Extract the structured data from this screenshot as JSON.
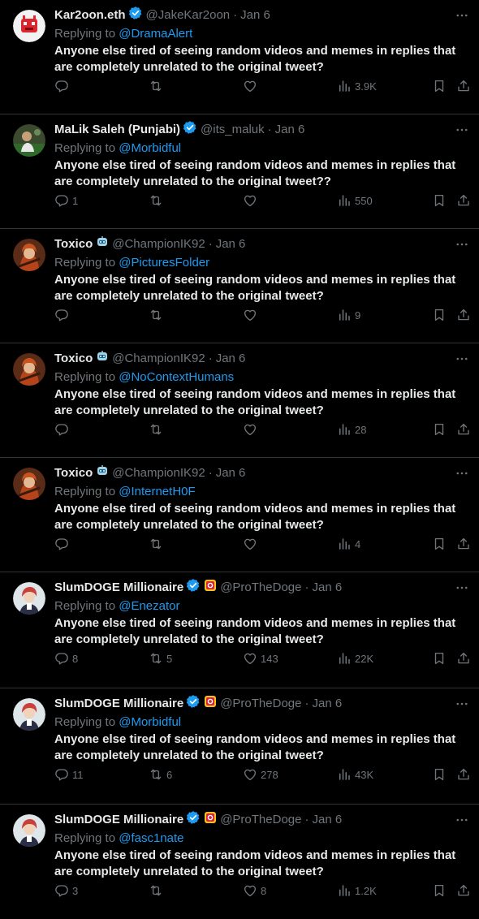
{
  "reply_text": "Anyone else tired of seeing random videos and memes in replies that are completely unrelated to the original tweet?",
  "replying_prefix": "Replying to",
  "colors": {
    "background": "#000000",
    "accent": "#1d9bf0",
    "muted": "#71767b",
    "verified": "#1d9bf0"
  },
  "tweets": [
    {
      "name": "Kar2oon.eth",
      "verified": true,
      "badge": false,
      "handle": "@JakeKar2oon",
      "date": "Jan 6",
      "replying_to": "@DramaAlert",
      "text": "Anyone else tired of seeing random videos and memes in replies that are completely unrelated to the original tweet?",
      "replies": "",
      "retweets": "",
      "likes": "",
      "views": "3.9K",
      "avatar": "red-robot-logo"
    },
    {
      "name": "MaLik Saleh (Punjabi)",
      "verified": true,
      "badge": false,
      "handle": "@its_maluk",
      "date": "Jan 6",
      "replying_to": "@Morbidful",
      "text": "Anyone else tired of seeing random videos and memes in replies that are completely unrelated to the original tweet??",
      "replies": "1",
      "retweets": "",
      "likes": "",
      "views": "550",
      "avatar": "photo-green"
    },
    {
      "name": "Toxico",
      "verified": false,
      "badge": false,
      "handle": "@ChampionIK92",
      "date": "Jan 6",
      "replying_to": "@PicturesFolder",
      "text": "Anyone else tired of seeing random videos and memes in replies that are completely unrelated to the original tweet?",
      "replies": "",
      "retweets": "",
      "likes": "",
      "views": "9",
      "avatar": "anime-orange-hair",
      "name_emoji": "robot-face-emoji"
    },
    {
      "name": "Toxico",
      "verified": false,
      "badge": false,
      "handle": "@ChampionIK92",
      "date": "Jan 6",
      "replying_to": "@NoContextHumans",
      "text": "Anyone else tired of seeing random videos and memes in replies that are completely unrelated to the original tweet?",
      "replies": "",
      "retweets": "",
      "likes": "",
      "views": "28",
      "avatar": "anime-orange-hair",
      "name_emoji": "robot-face-emoji"
    },
    {
      "name": "Toxico",
      "verified": false,
      "badge": false,
      "handle": "@ChampionIK92",
      "date": "Jan 6",
      "replying_to": "@InternetH0F",
      "text": "Anyone else tired of seeing random videos and memes in replies that are completely unrelated to the original tweet?",
      "replies": "",
      "retweets": "",
      "likes": "",
      "views": "4",
      "avatar": "anime-orange-hair",
      "name_emoji": "robot-face-emoji"
    },
    {
      "name": "SlumDOGE Millionaire",
      "verified": true,
      "badge": true,
      "handle": "@ProTheDoge",
      "date": "Jan 6",
      "replying_to": "@Enezator",
      "text": "Anyone else tired of seeing random videos and memes in replies that are completely unrelated to the original tweet?",
      "replies": "8",
      "retweets": "5",
      "likes": "143",
      "views": "22K",
      "avatar": "anime-red-hair"
    },
    {
      "name": "SlumDOGE Millionaire",
      "verified": true,
      "badge": true,
      "handle": "@ProTheDoge",
      "date": "Jan 6",
      "replying_to": "@Morbidful",
      "text": "Anyone else tired of seeing random videos and memes in replies that are completely unrelated to the original tweet?",
      "replies": "11",
      "retweets": "6",
      "likes": "278",
      "views": "43K",
      "avatar": "anime-red-hair"
    },
    {
      "name": "SlumDOGE Millionaire",
      "verified": true,
      "badge": true,
      "handle": "@ProTheDoge",
      "date": "Jan 6",
      "replying_to": "@fasc1nate",
      "text": "Anyone else tired of seeing random videos and memes in replies that are completely unrelated to the original tweet?",
      "replies": "3",
      "retweets": "",
      "likes": "8",
      "views": "1.2K",
      "avatar": "anime-red-hair"
    }
  ]
}
